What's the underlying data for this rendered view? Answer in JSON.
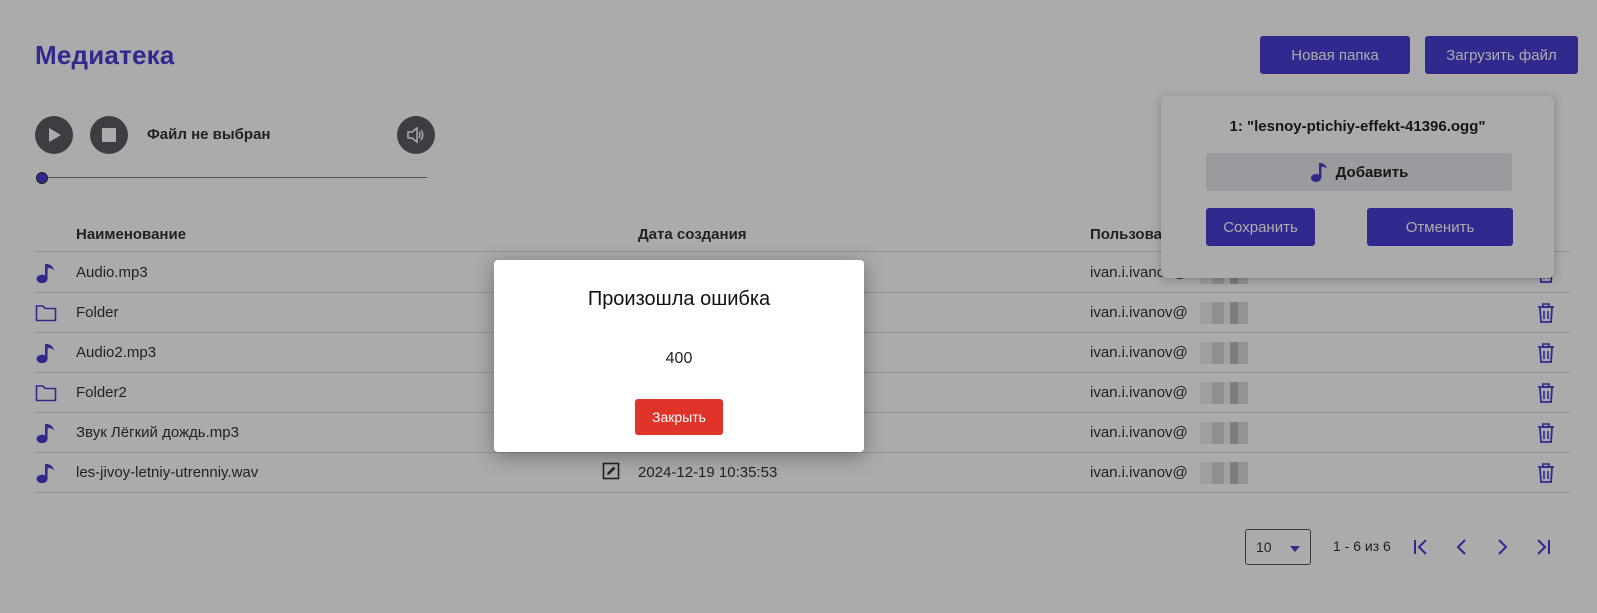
{
  "page": {
    "title": "Медиатека"
  },
  "toolbar": {
    "new_folder": "Новая папка",
    "upload_file": "Загрузить файл"
  },
  "player": {
    "status": "Файл не выбран",
    "progress": 0
  },
  "table": {
    "headers": {
      "name": "Наименование",
      "date": "Дата создания",
      "user": "Пользователь"
    },
    "rows": [
      {
        "type": "audio",
        "name": "Audio.mp3",
        "date": "",
        "user": "ivan.i.ivanov@"
      },
      {
        "type": "folder",
        "name": "Folder",
        "date": "",
        "user": "ivan.i.ivanov@"
      },
      {
        "type": "audio",
        "name": "Audio2.mp3",
        "date": "",
        "user": "ivan.i.ivanov@"
      },
      {
        "type": "folder",
        "name": "Folder2",
        "date": "",
        "user": "ivan.i.ivanov@"
      },
      {
        "type": "audio",
        "name": "Звук Лёгкий дождь.mp3",
        "date": "",
        "user": "ivan.i.ivanov@"
      },
      {
        "type": "audio",
        "name": "les-jivoy-letniy-utrenniy.wav",
        "date": "2024-12-19 10:35:53",
        "user": "ivan.i.ivanov@"
      }
    ]
  },
  "pagination": {
    "page_size": "10",
    "info": "1 - 6 из 6"
  },
  "upload_popup": {
    "file_label": "1: \"lesnoy-ptichiy-effekt-41396.ogg\"",
    "add_label": "Добавить",
    "save_label": "Сохранить",
    "cancel_label": "Отменить"
  },
  "error_modal": {
    "title": "Произошла ошибка",
    "code": "400",
    "close_label": "Закрыть"
  },
  "colors": {
    "accent": "#4a3fd4",
    "danger": "#e0342a",
    "overlay": "rgba(0,0,0,0.33)"
  }
}
